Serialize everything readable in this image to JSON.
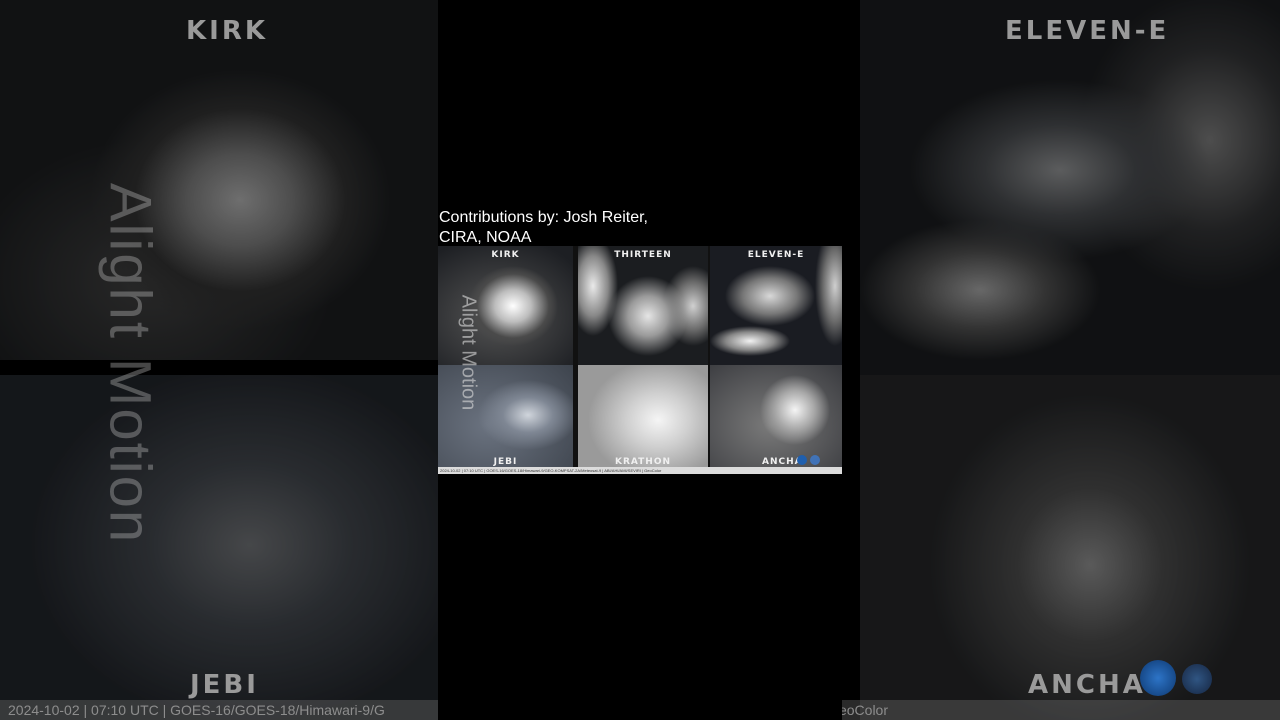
{
  "background": {
    "labels": {
      "top_left": "KIRK",
      "top_right": "ELEVEN-E",
      "bottom_left": "JEBI",
      "bottom_right": "ANCHA"
    },
    "watermark": "Alight Motion",
    "footer_left": "2024-10-02 | 07:10 UTC | GOES-16/GOES-18/Himawari-9/G",
    "footer_right": "eoColor"
  },
  "center": {
    "credit_line1": "Contributions by: Josh Reiter,",
    "credit_line2": "CIRA, NOAA",
    "panels": [
      {
        "label": "KIRK"
      },
      {
        "label": "THIRTEEN"
      },
      {
        "label": "ELEVEN-E"
      },
      {
        "label": "JEBI"
      },
      {
        "label": "KRATHON"
      },
      {
        "label": "ANCHA"
      }
    ],
    "watermark": "Alight Motion",
    "footer": "2024-10-02 | 07:10 UTC | GOES-16/GOES-18/Himawari-9/GEO-KOMPSAT-2A/Meteosat-9 | ABI/AHI/AMI/SEVIRI | GeoColor"
  },
  "colors": {
    "background": "#000000",
    "credit_text": "#ffffff",
    "noaa_blue": "#1f5fae",
    "cira_blue": "#3c7bd0"
  }
}
